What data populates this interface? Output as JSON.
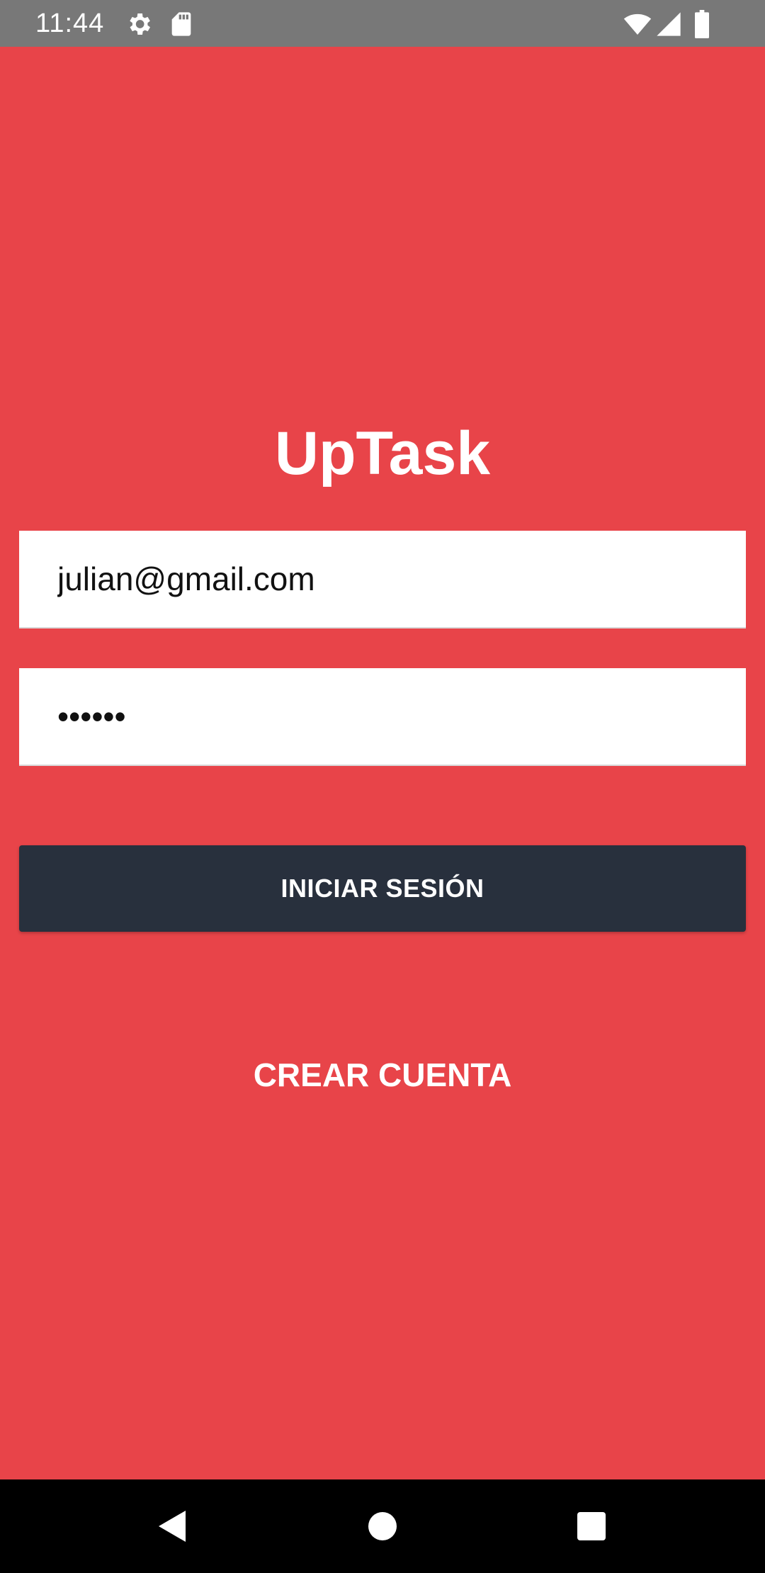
{
  "status_bar": {
    "time": "11:44",
    "icons": [
      "settings-icon",
      "sd-card-icon",
      "wifi-icon",
      "signal-icon",
      "battery-icon"
    ]
  },
  "app": {
    "title": "UpTask"
  },
  "form": {
    "email_value": "julian@gmail.com",
    "password_value": "••••••"
  },
  "buttons": {
    "login_label": "INICIAR SESIÓN",
    "create_account_label": "CREAR CUENTA"
  },
  "nav_bar": {
    "icons": [
      "back-icon",
      "home-icon",
      "recents-icon"
    ]
  },
  "colors": {
    "background": "#E84449",
    "button_dark": "#28303D",
    "status_bar": "#787878",
    "nav_bar": "#000000",
    "text_light": "#FFFFFF"
  }
}
